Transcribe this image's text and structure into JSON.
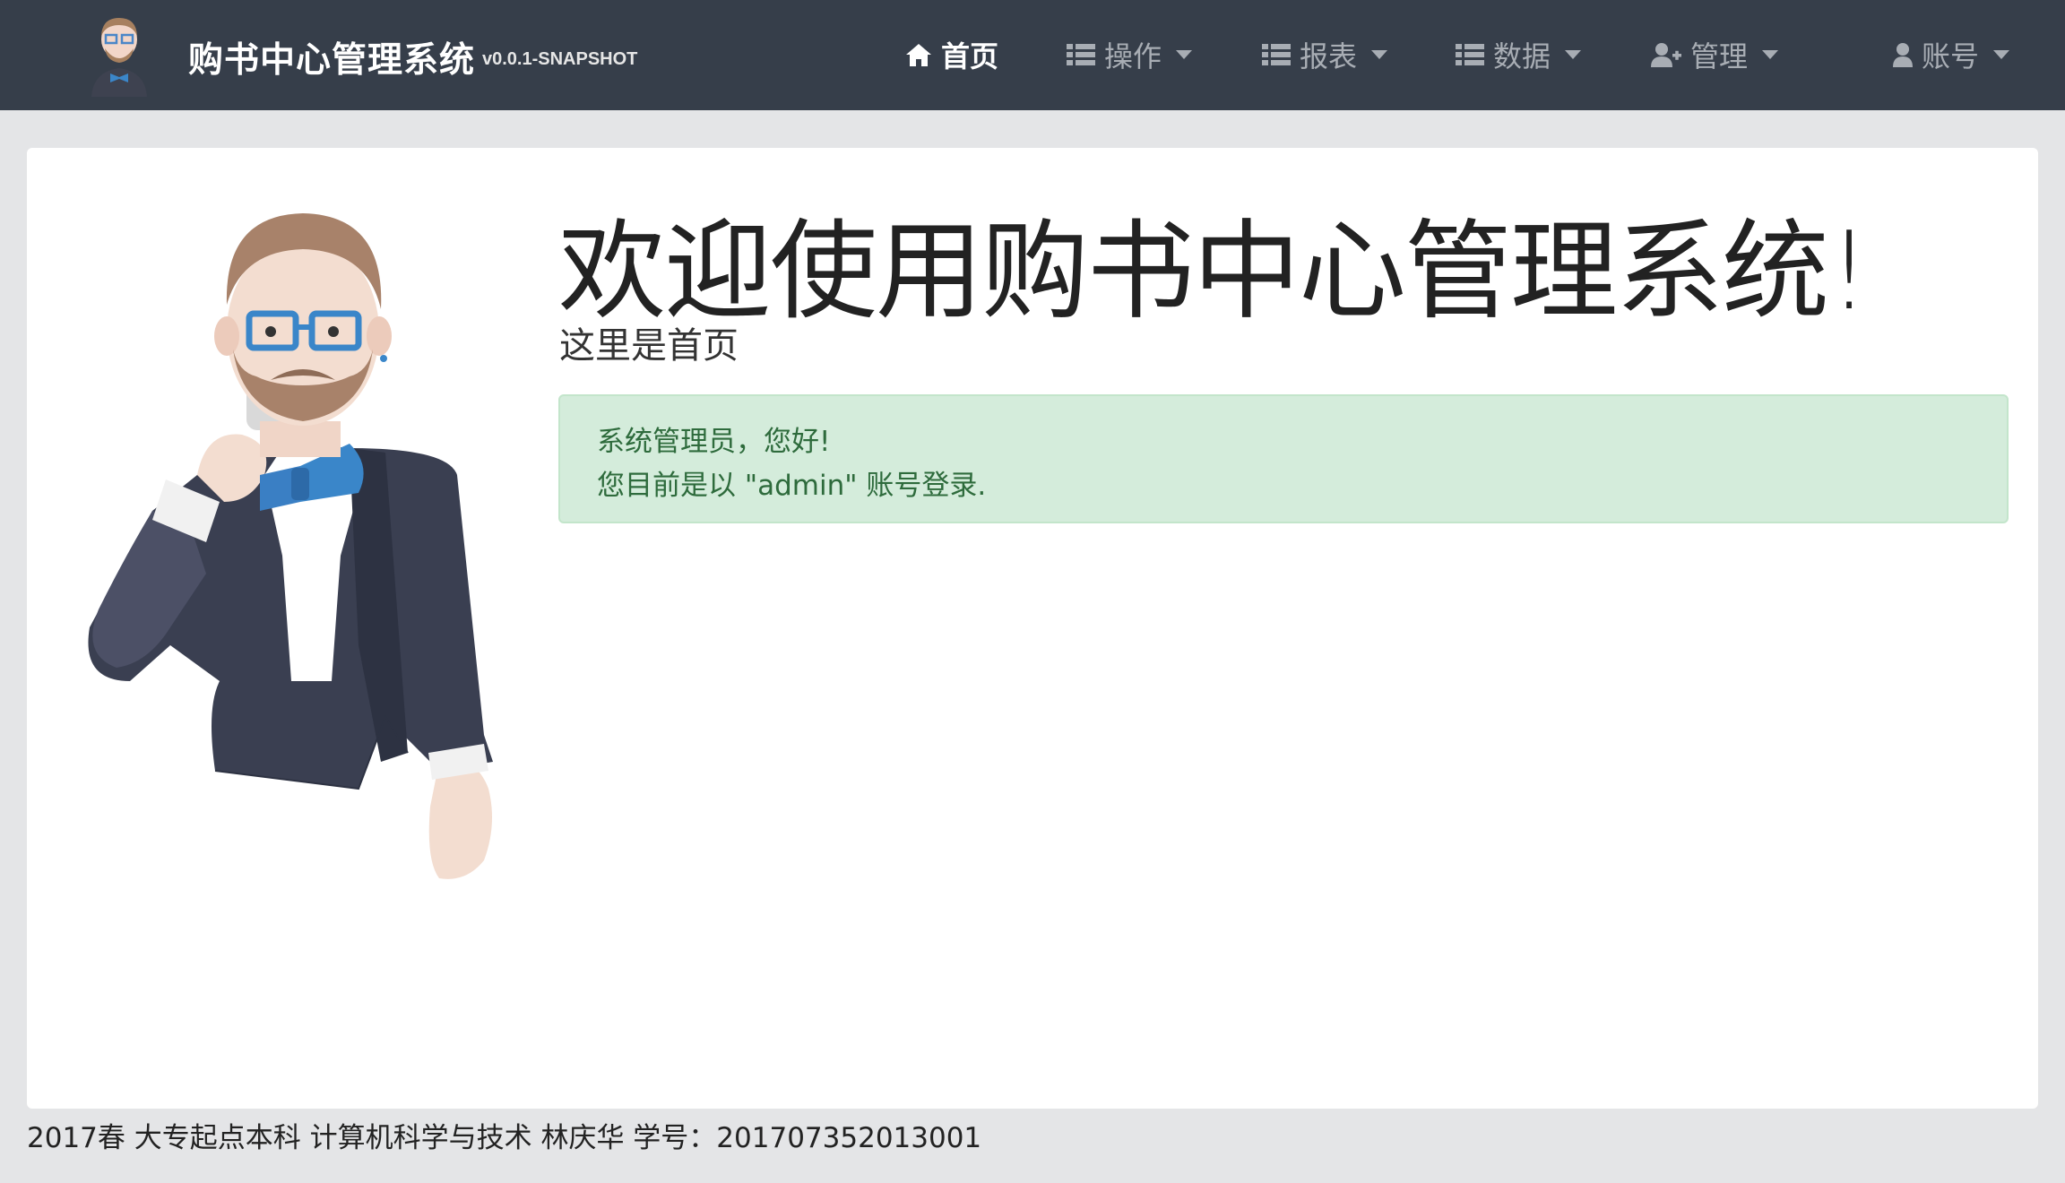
{
  "brand": {
    "title": "购书中心管理系统",
    "version": "v0.0.1-SNAPSHOT",
    "logo_icon": "mascot-logo-icon"
  },
  "nav": {
    "items": [
      {
        "label": "首页",
        "icon": "home-icon",
        "active": true,
        "dropdown": false
      },
      {
        "label": "操作",
        "icon": "list-icon",
        "active": false,
        "dropdown": true
      },
      {
        "label": "报表",
        "icon": "list-icon",
        "active": false,
        "dropdown": true
      },
      {
        "label": "数据",
        "icon": "list-icon",
        "active": false,
        "dropdown": true
      },
      {
        "label": "管理",
        "icon": "user-plus-icon",
        "active": false,
        "dropdown": true
      },
      {
        "label": "账号",
        "icon": "user-icon",
        "active": false,
        "dropdown": true
      }
    ]
  },
  "hero": {
    "title": "欢迎使用购书中心管理系统!",
    "subtitle": "这里是首页"
  },
  "alert": {
    "line1": "系统管理员，您好!",
    "line2": "您目前是以 \"admin\" 账号登录."
  },
  "footer": {
    "text": "2017春 大专起点本科 计算机科学与技术 林庆华 学号：201707352013001"
  },
  "colors": {
    "navbar_bg": "#363e4a",
    "page_bg": "#e4e5e7",
    "alert_bg": "#d4ecdb",
    "alert_text": "#2e6b3c"
  }
}
